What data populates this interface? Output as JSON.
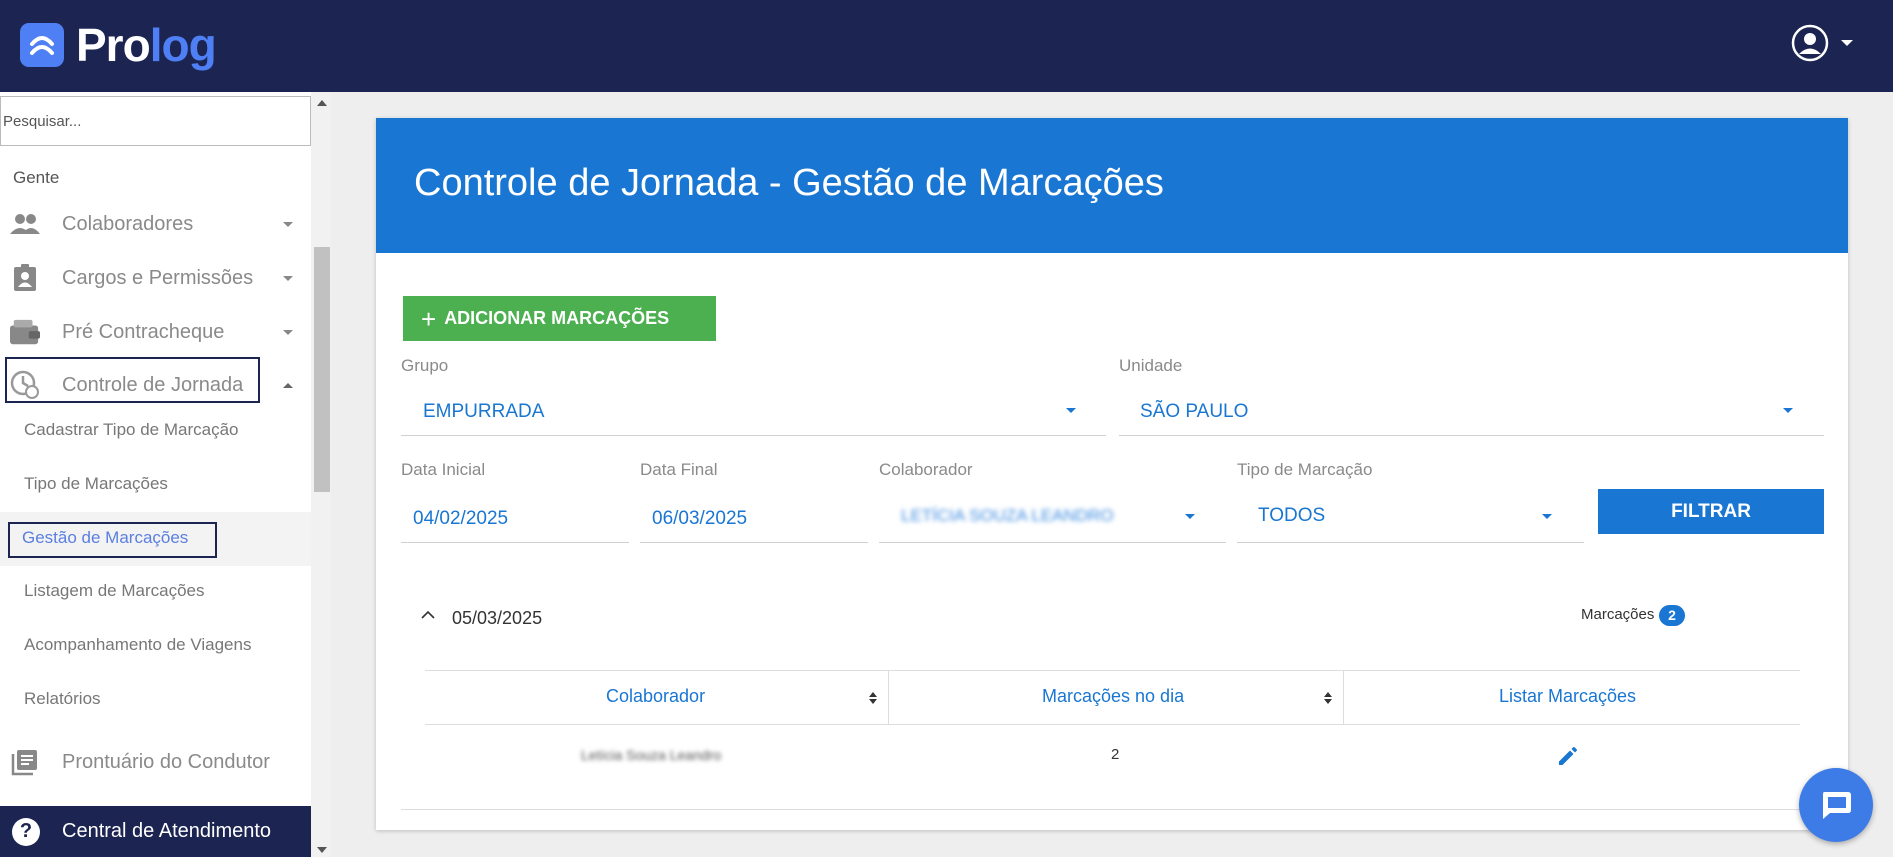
{
  "app": {
    "brand_pro": "Pro",
    "brand_log": "log"
  },
  "sidebar": {
    "search_placeholder": "Pesquisar...",
    "section": "Gente",
    "items": [
      {
        "label": "Colaboradores",
        "icon": "people-icon"
      },
      {
        "label": "Cargos e Permissões",
        "icon": "badge-icon"
      },
      {
        "label": "Pré Contracheque",
        "icon": "wallet-icon"
      },
      {
        "label": "Controle de Jornada",
        "icon": "clock-icon",
        "expanded": true
      },
      {
        "label": "Prontuário do Condutor",
        "icon": "library-icon"
      }
    ],
    "subitems": [
      "Cadastrar Tipo de Marcação",
      "Tipo de Marcações",
      "Gestão de Marcações",
      "Listagem de Marcações",
      "Acompanhamento de Viagens",
      "Relatórios"
    ],
    "active_subitem": "Gestão de Marcações",
    "central": "Central de Atendimento"
  },
  "page": {
    "title": "Controle de Jornada - Gestão de Marcações",
    "add_button": "ADICIONAR MARCAÇÕES",
    "filters": {
      "grupo": {
        "label": "Grupo",
        "value": "EMPURRADA"
      },
      "unidade": {
        "label": "Unidade",
        "value": "SÃO PAULO"
      },
      "data_inicial": {
        "label": "Data Inicial",
        "value": "04/02/2025"
      },
      "data_final": {
        "label": "Data Final",
        "value": "06/03/2025"
      },
      "colaborador": {
        "label": "Colaborador",
        "value": "LETÍCIA SOUZA LEANDRO"
      },
      "tipo": {
        "label": "Tipo de Marcação",
        "value": "TODOS"
      },
      "filter_button": "FILTRAR"
    },
    "group": {
      "date": "05/03/2025",
      "marcacoes_label": "Marcações",
      "marcacoes_count": "2"
    },
    "table": {
      "headers": [
        "Colaborador",
        "Marcações no dia",
        "Listar Marcações"
      ],
      "rows": [
        {
          "colaborador": "Letícia Souza Leandro",
          "marcacoes": "2"
        }
      ]
    }
  },
  "colors": {
    "header": "#1c2452",
    "primary": "#1976d2",
    "success": "#4caf50",
    "brand_accent": "#4f7ff5"
  }
}
